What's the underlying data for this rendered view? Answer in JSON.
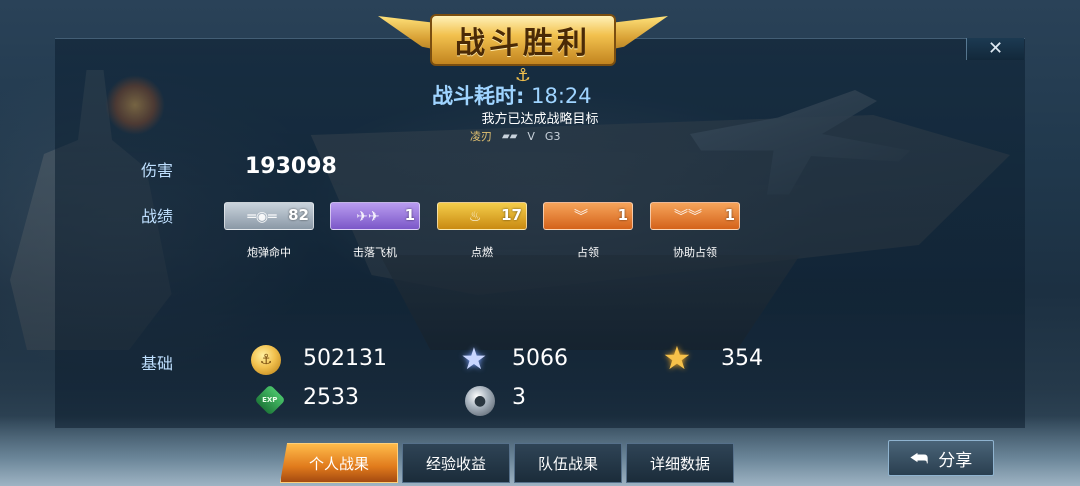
{
  "banner": {
    "title": "战斗胜利",
    "close_icon": "✕"
  },
  "battle": {
    "duration_label": "战斗耗时:",
    "duration_value": "18:24",
    "goal_text": "我方已达成战略目标",
    "ship_name": "凌刃",
    "ship_class": "V",
    "ship_tier": "G3"
  },
  "damage": {
    "label": "伤害",
    "value": "193098"
  },
  "achievements": {
    "label": "战绩",
    "items": [
      {
        "caption": "炮弹命中",
        "count": "82",
        "icon": "shell-icon",
        "color": "#a0adb9"
      },
      {
        "caption": "击落飞机",
        "count": "1",
        "icon": "plane-down-icon",
        "color": "#9a78dc"
      },
      {
        "caption": "点燃",
        "count": "17",
        "icon": "fire-icon",
        "color": "#e2ab2a"
      },
      {
        "caption": "占领",
        "count": "1",
        "icon": "chevron-capture-icon",
        "color": "#e8823a"
      },
      {
        "caption": "协助占领",
        "count": "1",
        "icon": "chevron-assist-icon",
        "color": "#e8823a"
      }
    ]
  },
  "rewards": {
    "label": "基础",
    "coins": "502131",
    "stars": "5066",
    "gold_stars": "354",
    "exp": "2533",
    "orbs": "3",
    "exp_icon_text": "EXP"
  },
  "tabs": [
    {
      "label": "个人战果",
      "active": true
    },
    {
      "label": "经验收益",
      "active": false
    },
    {
      "label": "队伍战果",
      "active": false
    },
    {
      "label": "详细数据",
      "active": false
    }
  ],
  "share": {
    "label": "分享"
  }
}
